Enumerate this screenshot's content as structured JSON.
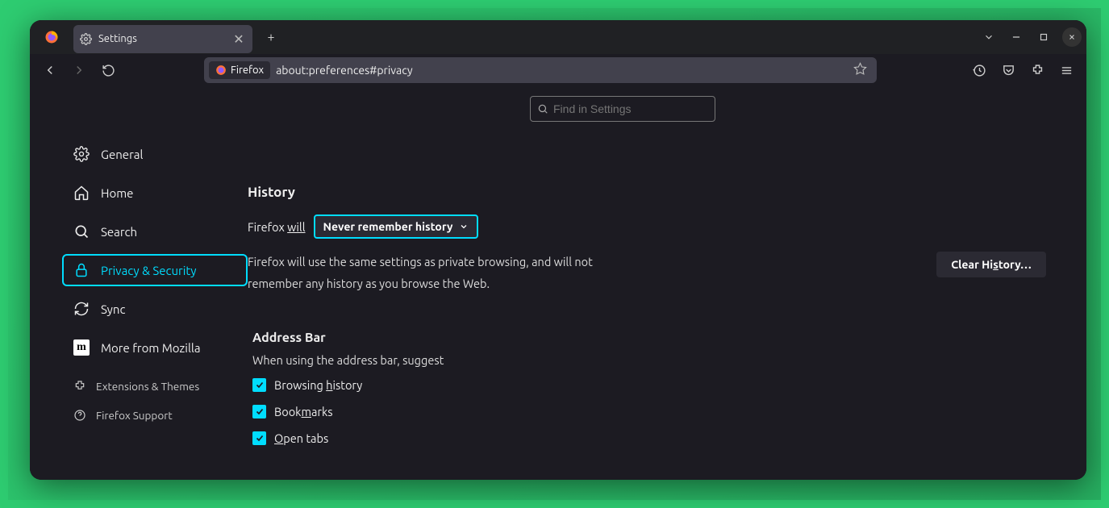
{
  "tab": {
    "title": "Settings"
  },
  "urlbar": {
    "badge": "Firefox",
    "url": "about:preferences#privacy"
  },
  "search": {
    "placeholder": "Find in Settings"
  },
  "sidebar": {
    "general": "General",
    "home": "Home",
    "search": "Search",
    "privacy": "Privacy & Security",
    "sync": "Sync",
    "more": "More from Mozilla",
    "ext": "Extensions & Themes",
    "support": "Firefox Support"
  },
  "history": {
    "title": "History",
    "prefix": "Firefox ",
    "will": "will",
    "dropdown": "Never remember history",
    "desc": "Firefox will use the same settings as private browsing, and will not remember any history as you browse the Web.",
    "clear_pre": "Clear Hi",
    "clear_u": "s",
    "clear_post": "tory…"
  },
  "address": {
    "title": "Address Bar",
    "desc": "When using the address bar, suggest",
    "opt1_pre": "Browsing ",
    "opt1_u": "h",
    "opt1_post": "istory",
    "opt2_pre": "Book",
    "opt2_u": "m",
    "opt2_post": "arks",
    "opt3_u": "O",
    "opt3_post": "pen tabs"
  }
}
